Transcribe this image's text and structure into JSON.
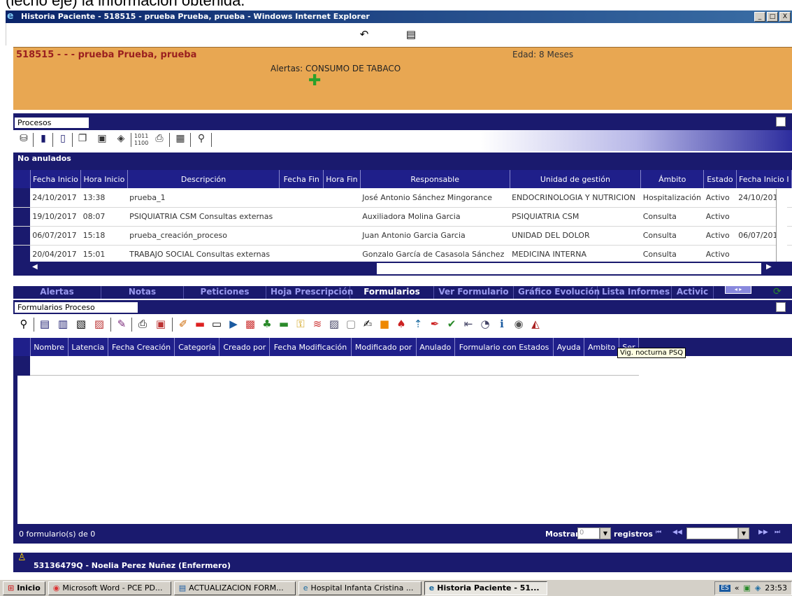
{
  "doc_snippet": "(lecho eje) la información obtenida.",
  "window": {
    "title": "Historia Paciente - 518515 - prueba Prueba, prueba - Windows Internet Explorer",
    "minimize": "_",
    "maximize": "□",
    "close": "X"
  },
  "patient": {
    "name_line": "518515 - - - prueba Prueba, prueba",
    "edad": "Edad: 8 Meses",
    "alertas": "Alertas: CONSUMO DE TABACO"
  },
  "procesos": {
    "label": "Procesos",
    "no_anulados": "No anulados",
    "columns": [
      "Fecha Inicio",
      "Hora Inicio",
      "Descripción",
      "Fecha Fin",
      "Hora Fin",
      "Responsable",
      "Unidad de gestión",
      "Ámbito",
      "Estado",
      "Fecha Inicio I"
    ],
    "rows": [
      [
        "24/10/2017",
        "13:38",
        "prueba_1",
        "",
        "",
        "José Antonio Sánchez Mingorance",
        "ENDOCRINOLOGIA Y NUTRICION",
        "Hospitalización",
        "Activo",
        "24/10/201"
      ],
      [
        "19/10/2017",
        "08:07",
        "PSIQUIATRIA CSM Consultas externas",
        "",
        "",
        "Auxiliadora Molina Garcia",
        "PSIQUIATRIA CSM",
        "Consulta",
        "Activo",
        ""
      ],
      [
        "06/07/2017",
        "15:18",
        "prueba_creación_proceso",
        "",
        "",
        "Juan Antonio Garcia Garcia",
        "UNIDAD DEL DOLOR",
        "Consulta",
        "Activo",
        "06/07/201"
      ],
      [
        "20/04/2017",
        "15:01",
        "TRABAJO SOCIAL Consultas externas",
        "",
        "",
        "Gonzalo García de Casasola Sánchez",
        "MEDICINA INTERNA",
        "Consulta",
        "Activo",
        ""
      ]
    ]
  },
  "tabs": [
    {
      "label": "Alertas",
      "active": false
    },
    {
      "label": "Notas",
      "active": false
    },
    {
      "label": "Peticiones",
      "active": false
    },
    {
      "label": "Hoja Prescripción",
      "active": false
    },
    {
      "label": "Formularios",
      "active": true
    },
    {
      "label": "Ver Formulario",
      "active": false
    },
    {
      "label": "Gráfico Evolución",
      "active": false
    },
    {
      "label": "Lista Informes",
      "active": false
    },
    {
      "label": "Activic",
      "active": false
    }
  ],
  "formularios": {
    "label": "Formularios Proceso",
    "columns": [
      "Nombre",
      "Latencia",
      "Fecha Creación",
      "Categoría",
      "Creado por",
      "Fecha Modificación",
      "Modificado por",
      "Anulado",
      "Formulario con Estados",
      "Ayuda",
      "Ambito",
      "Ser"
    ],
    "tooltip": "Vig. nocturna PSQ",
    "count_text": "0 formulario(s) de 0",
    "mostrar_label": "Mostrar",
    "mostrar_value": "0",
    "registros_label": "registros"
  },
  "user": {
    "text": "53136479Q - Noelia Perez Nuñez (Enfermero)"
  },
  "taskbar": {
    "start": "Inicio",
    "tasks": [
      {
        "label": "Microsoft Word - PCE PD...",
        "active": false
      },
      {
        "label": "ACTUALIZACION FORM...",
        "active": false
      },
      {
        "label": "Hospital Infanta Cristina ...",
        "active": false
      },
      {
        "label": "Historia Paciente - 51...",
        "active": true
      }
    ],
    "lang": "ES",
    "clock": "23:53"
  },
  "colors": {
    "navy": "#1a1a6e",
    "patient_bg": "#e8a752",
    "patient_name": "#9a1f1f"
  }
}
